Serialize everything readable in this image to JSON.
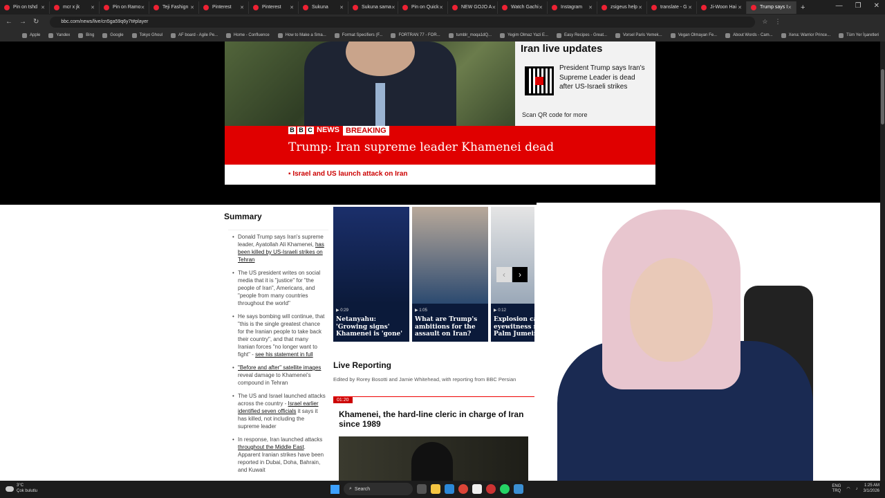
{
  "browser": {
    "tabs": [
      {
        "label": "Pin on tshd",
        "icon": "pinterest-icon",
        "active": false
      },
      {
        "label": "mcr x jk",
        "icon": "pinterest-icon",
        "active": false
      },
      {
        "label": "Pin on Ramo",
        "icon": "pinterest-icon",
        "active": false
      },
      {
        "label": "Teji Fashign",
        "icon": "pinterest-icon",
        "active": false
      },
      {
        "label": "Pinterest",
        "icon": "pinterest-icon",
        "active": false
      },
      {
        "label": "Pinterest",
        "icon": "pinterest-icon",
        "active": false
      },
      {
        "label": "Sukuna",
        "icon": "pinterest-icon",
        "active": false
      },
      {
        "label": "Sukuna sama",
        "icon": "pinterest-icon",
        "active": false
      },
      {
        "label": "Pin on Quick",
        "icon": "pinterest-icon",
        "active": false
      },
      {
        "label": "NEW GOJO A",
        "icon": "pinterest-icon",
        "active": false
      },
      {
        "label": "Watch Gachi",
        "icon": "web-icon",
        "active": false
      },
      {
        "label": "Instagram",
        "icon": "instagram-icon",
        "active": false
      },
      {
        "label": "zsigeus help",
        "icon": "web-icon",
        "active": false
      },
      {
        "label": "translate - G",
        "icon": "web-icon",
        "active": false
      },
      {
        "label": "Ji-Woon Hai",
        "icon": "web-icon",
        "active": false
      },
      {
        "label": "Trump says I",
        "icon": "bbc-icon",
        "active": true
      }
    ],
    "url": "bbc.com/news/live/cn5ga59q6y7t#player",
    "bookmarks": [
      "Apple",
      "Yandex",
      "Bing",
      "Google",
      "Tokyo Ghoul",
      "AF board - Agile Pe...",
      "Home - Confluence",
      "How to Make a Sma...",
      "Format Specifiers (F...",
      "FORTRAN 77 - FOR...",
      "tumblr_moqa1dQ...",
      "Yegim Olmaz Yazi E...",
      "Easy Recipes - Great...",
      "Vorsel Paris Yemek...",
      "Vegan Olmayan Fe...",
      "About Words - Cam...",
      "Xena: Warrior Prince...",
      "Tüm Yer İşaretleri"
    ]
  },
  "hero": {
    "panel_title": "Iran live updates",
    "qr_text": "President Trump says Iran's Supreme Leader is dead after US-Israeli strikes",
    "scan_text": "Scan QR code for more",
    "logo_letters": [
      "B",
      "B",
      "C"
    ],
    "logo_news": "NEWS",
    "breaking": "BREAKING",
    "headline": "Trump: Iran supreme leader Khamenei dead",
    "ticker": "Israel and US launch attack on Iran"
  },
  "summary": {
    "title": "Summary",
    "items": [
      {
        "pre": "Donald Trump says Iran's supreme leader, Ayatollah Ali Khamenei, ",
        "link": "has been killed by US-Israeli strikes on Tehran",
        "post": ""
      },
      {
        "pre": "The US president writes on social media that it is \"justice\" for \"the people of Iran\", Americans, and \"people from many countries throughout the world\"",
        "link": "",
        "post": ""
      },
      {
        "pre": "He says bombing will continue, that \"this is the single greatest chance for the Iranian people to take back their country\", and that many Iranian forces \"no longer want to fight\" - ",
        "link": "see his statement in full",
        "post": ""
      },
      {
        "pre": "",
        "link": "\"Before and after\" satellite images",
        "post": " reveal damage to Khamenei's compound in Tehran"
      },
      {
        "pre": "The US and Israel launched attacks across the country - ",
        "link": "Israel earlier identified seven officials",
        "post": " it says it has killed, not including the supreme leader"
      },
      {
        "pre": "In response, Iran launched attacks ",
        "link": "throughout the Middle East",
        "post": ". Apparent Iranian strikes have been reported in Dubai, Doha, Bahrain, and Kuwait"
      }
    ]
  },
  "videos": [
    {
      "duration": "▶ 0:29",
      "title": "Netanyahu: 'Growing signs' Khamenei is 'gone'"
    },
    {
      "duration": "▶ 1:05",
      "title": "What are Trump's ambitions for the assault on Iran?"
    },
    {
      "duration": "▶ 0:12",
      "title": "Explosion caught by eyewitness near The Palm Jumeirah"
    }
  ],
  "carousel": {
    "prev": "‹",
    "next": "›"
  },
  "live": {
    "title": "Live Reporting",
    "edited": "Edited by Rorey Bosotti and Jamie Whitehead, with reporting from BBC Persian",
    "post_time": "01:20",
    "post_title": "Khamenei, the hard-line cleric in charge of Iran since 1989"
  },
  "taskbar": {
    "weather_temp": "3°C",
    "weather_desc": "Çok bulutlu",
    "search": "Search",
    "lang_top": "ENG",
    "lang_bottom": "TRQ",
    "time": "1:25 AM",
    "date": "3/1/2026"
  }
}
